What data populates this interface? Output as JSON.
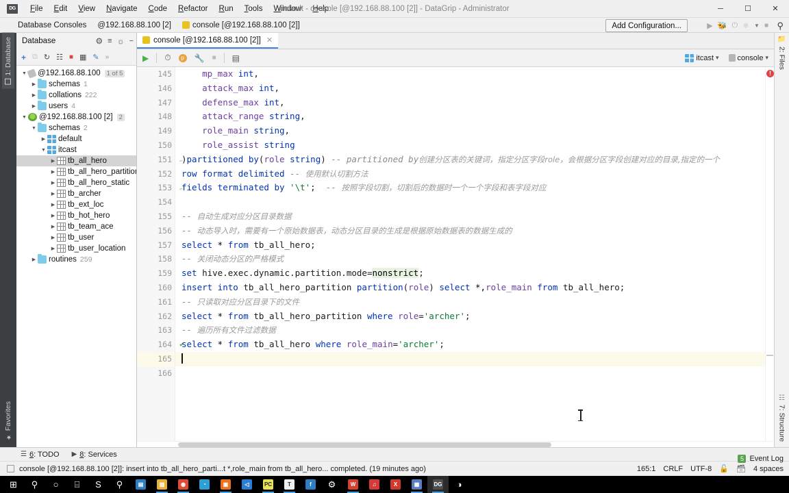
{
  "window": {
    "title": "default - console [@192.168.88.100 [2]] - DataGrip - Administrator",
    "app_icon_label": "DG",
    "minimize": "─",
    "maximize": "☐",
    "close": "✕"
  },
  "menu": [
    {
      "label": "File"
    },
    {
      "label": "Edit"
    },
    {
      "label": "View"
    },
    {
      "label": "Navigate"
    },
    {
      "label": "Code"
    },
    {
      "label": "Refactor"
    },
    {
      "label": "Run"
    },
    {
      "label": "Tools"
    },
    {
      "label": "Window"
    },
    {
      "label": "Help"
    }
  ],
  "consoles_bar": {
    "label": "Database Consoles",
    "breadcrumb": "@192.168.88.100 [2]",
    "console_item": "console [@192.168.88.100 [2]]",
    "add_configuration": "Add Configuration...",
    "run_icon": "run-icon",
    "debug_icon": "debug-icon",
    "coverage_icon": "coverage-icon",
    "profile_icon": "profile-icon",
    "stop_icon": "stop-icon",
    "search_icon": "search-icon"
  },
  "left_strip": {
    "database_tab": "1: Database",
    "favorites_tab": "Favorites"
  },
  "database_panel": {
    "title": "Database",
    "header_icons": [
      "sync-icon",
      "collapse-icon",
      "settings-icon",
      "hide-icon"
    ],
    "toolbar_icons": [
      "add-icon",
      "duplicate-icon",
      "refresh-icon",
      "run-script-icon",
      "stop-icon",
      "table-editor-icon",
      "modify-icon",
      "more-icon"
    ],
    "tree": [
      {
        "indent": 0,
        "arrow": "▼",
        "icon": "db-offline-icon",
        "name": "@192.168.88.100",
        "badge": "1 of 5",
        "count": "",
        "selected": false
      },
      {
        "indent": 1,
        "arrow": "▶",
        "icon": "folder-icon",
        "name": "schemas",
        "badge": "",
        "count": "1",
        "selected": false
      },
      {
        "indent": 1,
        "arrow": "▶",
        "icon": "folder-icon",
        "name": "collations",
        "badge": "",
        "count": "222",
        "selected": false
      },
      {
        "indent": 1,
        "arrow": "▶",
        "icon": "folder-icon",
        "name": "users",
        "badge": "",
        "count": "4",
        "selected": false
      },
      {
        "indent": 0,
        "arrow": "▼",
        "icon": "db-online-icon",
        "name": "@192.168.88.100 [2]",
        "badge": "2",
        "count": "",
        "selected": false
      },
      {
        "indent": 1,
        "arrow": "▼",
        "icon": "folder-icon",
        "name": "schemas",
        "badge": "",
        "count": "2",
        "selected": false
      },
      {
        "indent": 2,
        "arrow": "▶",
        "icon": "schema-icon",
        "name": "default",
        "badge": "",
        "count": "",
        "selected": false
      },
      {
        "indent": 2,
        "arrow": "▼",
        "icon": "schema-icon",
        "name": "itcast",
        "badge": "",
        "count": "",
        "selected": false
      },
      {
        "indent": 3,
        "arrow": "▶",
        "icon": "table-icon",
        "name": "tb_all_hero",
        "badge": "",
        "count": "",
        "selected": true
      },
      {
        "indent": 3,
        "arrow": "▶",
        "icon": "table-icon",
        "name": "tb_all_hero_partition",
        "badge": "",
        "count": "",
        "selected": false
      },
      {
        "indent": 3,
        "arrow": "▶",
        "icon": "table-icon",
        "name": "tb_all_hero_static",
        "badge": "",
        "count": "",
        "selected": false
      },
      {
        "indent": 3,
        "arrow": "▶",
        "icon": "table-icon",
        "name": "tb_archer",
        "badge": "",
        "count": "",
        "selected": false
      },
      {
        "indent": 3,
        "arrow": "▶",
        "icon": "table-icon",
        "name": "tb_ext_loc",
        "badge": "",
        "count": "",
        "selected": false
      },
      {
        "indent": 3,
        "arrow": "▶",
        "icon": "table-icon",
        "name": "tb_hot_hero",
        "badge": "",
        "count": "",
        "selected": false
      },
      {
        "indent": 3,
        "arrow": "▶",
        "icon": "table-icon",
        "name": "tb_team_ace",
        "badge": "",
        "count": "",
        "selected": false
      },
      {
        "indent": 3,
        "arrow": "▶",
        "icon": "table-icon",
        "name": "tb_user",
        "badge": "",
        "count": "",
        "selected": false
      },
      {
        "indent": 3,
        "arrow": "▶",
        "icon": "table-icon",
        "name": "tb_user_location",
        "badge": "",
        "count": "",
        "selected": false
      },
      {
        "indent": 1,
        "arrow": "▶",
        "icon": "folder-icon",
        "name": "routines",
        "badge": "",
        "count": "259",
        "selected": false
      }
    ]
  },
  "editor": {
    "tab_label": "console [@192.168.88.100 [2]]",
    "tab_close": "✕",
    "toolbar_icons": [
      "execute-icon",
      "history-icon",
      "parameters-icon",
      "wrench-icon",
      "stop-icon",
      "grid-icon"
    ],
    "schema_chip": "itcast",
    "session_chip": "console",
    "chevron": "⌄",
    "first_line_number": 145,
    "lines": [
      {
        "n": 145,
        "segments": [
          {
            "t": "plain",
            "s": "    "
          },
          {
            "t": "col",
            "s": "mp_max"
          },
          {
            "t": "plain",
            "s": " "
          },
          {
            "t": "kw",
            "s": "int"
          },
          {
            "t": "punct",
            "s": ","
          }
        ]
      },
      {
        "n": 146,
        "segments": [
          {
            "t": "plain",
            "s": "    "
          },
          {
            "t": "col",
            "s": "attack_max"
          },
          {
            "t": "plain",
            "s": " "
          },
          {
            "t": "kw",
            "s": "int"
          },
          {
            "t": "punct",
            "s": ","
          }
        ]
      },
      {
        "n": 147,
        "segments": [
          {
            "t": "plain",
            "s": "    "
          },
          {
            "t": "col",
            "s": "defense_max"
          },
          {
            "t": "plain",
            "s": " "
          },
          {
            "t": "kw",
            "s": "int"
          },
          {
            "t": "punct",
            "s": ","
          }
        ]
      },
      {
        "n": 148,
        "segments": [
          {
            "t": "plain",
            "s": "    "
          },
          {
            "t": "col",
            "s": "attack_range"
          },
          {
            "t": "plain",
            "s": " "
          },
          {
            "t": "kw",
            "s": "string"
          },
          {
            "t": "punct",
            "s": ","
          }
        ]
      },
      {
        "n": 149,
        "segments": [
          {
            "t": "plain",
            "s": "    "
          },
          {
            "t": "col",
            "s": "role_main"
          },
          {
            "t": "plain",
            "s": " "
          },
          {
            "t": "kw",
            "s": "string"
          },
          {
            "t": "punct",
            "s": ","
          }
        ]
      },
      {
        "n": 150,
        "segments": [
          {
            "t": "plain",
            "s": "    "
          },
          {
            "t": "col",
            "s": "role_assist"
          },
          {
            "t": "plain",
            "s": " "
          },
          {
            "t": "kw",
            "s": "string"
          }
        ]
      },
      {
        "n": 151,
        "fold": true,
        "segments": [
          {
            "t": "punct",
            "s": ")"
          },
          {
            "t": "kw",
            "s": "partitioned by"
          },
          {
            "t": "punct",
            "s": "("
          },
          {
            "t": "col",
            "s": "role"
          },
          {
            "t": "plain",
            "s": " "
          },
          {
            "t": "kw",
            "s": "string"
          },
          {
            "t": "punct",
            "s": ")"
          },
          {
            "t": "cmt",
            "s": " -- "
          },
          {
            "t": "cmt",
            "s": "partitioned by"
          },
          {
            "t": "cmt-cn",
            "s": "创建分区表的关键词，指定分区字段role，会根据分区字段创建对应的目录,指定的一个"
          }
        ]
      },
      {
        "n": 152,
        "segments": [
          {
            "t": "kw",
            "s": "row format delimited"
          },
          {
            "t": "cmt",
            "s": " -- "
          },
          {
            "t": "cmt-cn",
            "s": "使用默认切割方法"
          }
        ]
      },
      {
        "n": 153,
        "fold": true,
        "segments": [
          {
            "t": "kw",
            "s": "fields terminated by"
          },
          {
            "t": "plain",
            "s": " "
          },
          {
            "t": "str",
            "s": "'\\t'"
          },
          {
            "t": "punct",
            "s": ";"
          },
          {
            "t": "cmt",
            "s": "  -- "
          },
          {
            "t": "cmt-cn",
            "s": "按照字段切割，切割后的数据时一个一个字段和表字段对应"
          }
        ]
      },
      {
        "n": 154,
        "segments": []
      },
      {
        "n": 155,
        "segments": [
          {
            "t": "cmt",
            "s": "-- "
          },
          {
            "t": "cmt-cn",
            "s": "自动生成对应分区目录数据"
          }
        ]
      },
      {
        "n": 156,
        "segments": [
          {
            "t": "cmt",
            "s": "-- "
          },
          {
            "t": "cmt-cn",
            "s": "动态导入时，需要有一个原始数据表，动态分区目录的生成是根据原始数据表的数据生成的"
          }
        ]
      },
      {
        "n": 157,
        "segments": [
          {
            "t": "kw",
            "s": "select"
          },
          {
            "t": "plain",
            "s": " * "
          },
          {
            "t": "kw",
            "s": "from"
          },
          {
            "t": "plain",
            "s": " "
          },
          {
            "t": "tbl",
            "s": "tb_all_hero"
          },
          {
            "t": "punct",
            "s": ";"
          }
        ]
      },
      {
        "n": 158,
        "segments": [
          {
            "t": "cmt",
            "s": "-- "
          },
          {
            "t": "cmt-cn",
            "s": "关闭动态分区的严格模式"
          }
        ]
      },
      {
        "n": 159,
        "segments": [
          {
            "t": "kw",
            "s": "set"
          },
          {
            "t": "plain",
            "s": " "
          },
          {
            "t": "id",
            "s": "hive.exec.dynamic.partition.mode"
          },
          {
            "t": "punct",
            "s": "="
          },
          {
            "t": "hl",
            "s": "nonstrict"
          },
          {
            "t": "punct",
            "s": ";"
          }
        ]
      },
      {
        "n": 160,
        "segments": [
          {
            "t": "kw",
            "s": "insert into"
          },
          {
            "t": "plain",
            "s": " "
          },
          {
            "t": "tbl",
            "s": "tb_all_hero_partition"
          },
          {
            "t": "plain",
            "s": " "
          },
          {
            "t": "kw",
            "s": "partition"
          },
          {
            "t": "punct",
            "s": "("
          },
          {
            "t": "col",
            "s": "role"
          },
          {
            "t": "punct",
            "s": ") "
          },
          {
            "t": "kw",
            "s": "select"
          },
          {
            "t": "plain",
            "s": " *,"
          },
          {
            "t": "col",
            "s": "role_main"
          },
          {
            "t": "plain",
            "s": " "
          },
          {
            "t": "kw",
            "s": "from"
          },
          {
            "t": "plain",
            "s": " "
          },
          {
            "t": "tbl",
            "s": "tb_all_hero"
          },
          {
            "t": "punct",
            "s": ";"
          }
        ]
      },
      {
        "n": 161,
        "segments": [
          {
            "t": "cmt",
            "s": "-- "
          },
          {
            "t": "cmt-cn",
            "s": "只读取对应分区目录下的文件"
          }
        ]
      },
      {
        "n": 162,
        "segments": [
          {
            "t": "kw",
            "s": "select"
          },
          {
            "t": "plain",
            "s": " * "
          },
          {
            "t": "kw",
            "s": "from"
          },
          {
            "t": "plain",
            "s": " "
          },
          {
            "t": "tbl",
            "s": "tb_all_hero_partition"
          },
          {
            "t": "plain",
            "s": " "
          },
          {
            "t": "kw",
            "s": "where"
          },
          {
            "t": "plain",
            "s": " "
          },
          {
            "t": "col",
            "s": "role"
          },
          {
            "t": "punct",
            "s": "="
          },
          {
            "t": "str",
            "s": "'archer'"
          },
          {
            "t": "punct",
            "s": ";"
          }
        ]
      },
      {
        "n": 163,
        "segments": [
          {
            "t": "cmt",
            "s": "-- "
          },
          {
            "t": "cmt-cn",
            "s": "遍历所有文件过滤数据"
          }
        ]
      },
      {
        "n": 164,
        "check": true,
        "segments": [
          {
            "t": "kw",
            "s": "select"
          },
          {
            "t": "plain",
            "s": " * "
          },
          {
            "t": "kw",
            "s": "from"
          },
          {
            "t": "plain",
            "s": " "
          },
          {
            "t": "tbl",
            "s": "tb_all_hero"
          },
          {
            "t": "plain",
            "s": " "
          },
          {
            "t": "kw",
            "s": "where"
          },
          {
            "t": "plain",
            "s": " "
          },
          {
            "t": "col",
            "s": "role_main"
          },
          {
            "t": "punct",
            "s": "="
          },
          {
            "t": "str",
            "s": "'archer'"
          },
          {
            "t": "punct",
            "s": ";"
          }
        ]
      },
      {
        "n": 165,
        "current": true,
        "caret": true,
        "segments": []
      },
      {
        "n": 166,
        "segments": []
      }
    ]
  },
  "right_strip": {
    "files_tab": "2: Files",
    "structure_tab": "7: Structure"
  },
  "bottom_toolwindows": [
    {
      "icon": "todo-icon",
      "key": "6",
      "label": ": TODO"
    },
    {
      "icon": "services-icon",
      "key": "8",
      "label": ": Services"
    }
  ],
  "statusbar": {
    "message_icon": "console-icon",
    "message": "console [@192.168.88.100 [2]]: insert into tb_all_hero_parti...t *,role_main from tb_all_hero... completed. (19 minutes ago)",
    "caret_position": "165:1",
    "line_separator": "CRLF",
    "encoding": "UTF-8",
    "lock_icon": "unlocked-icon",
    "vcs_icon": "branch-icon",
    "indent": "4 spaces"
  },
  "event_log": {
    "badge": "5",
    "label": "Event Log"
  },
  "taskbar": [
    {
      "name": "start-button",
      "glyph": "⊞",
      "color": "#ffffff",
      "bg": "transparent",
      "active": false,
      "underline": false
    },
    {
      "name": "search-icon",
      "glyph": "⚲",
      "color": "#ffffff",
      "bg": "transparent",
      "active": false,
      "underline": false
    },
    {
      "name": "cortana-icon",
      "glyph": "○",
      "color": "#ffffff",
      "bg": "transparent",
      "active": false,
      "underline": false
    },
    {
      "name": "task-view-icon",
      "glyph": "⌸",
      "color": "#ffffff",
      "bg": "transparent",
      "active": false,
      "underline": false
    },
    {
      "name": "app-sogou-icon",
      "glyph": "S",
      "color": "#ffffff",
      "bg": "transparent",
      "active": false,
      "underline": false
    },
    {
      "name": "app-search-icon",
      "glyph": "⚲",
      "color": "#ffffff",
      "bg": "transparent",
      "active": false,
      "underline": false
    },
    {
      "name": "app-store-icon",
      "glyph": "▤",
      "color": "#ffffff",
      "bg": "#2e7ec4",
      "active": false,
      "underline": false
    },
    {
      "name": "app-explorer-icon",
      "glyph": "▧",
      "color": "#ffffff",
      "bg": "#e8b23a",
      "active": false,
      "underline": true
    },
    {
      "name": "app-chrome-icon",
      "glyph": "◉",
      "color": "#ffffff",
      "bg": "#e04a36",
      "active": false,
      "underline": true
    },
    {
      "name": "app-edge-icon",
      "glyph": "◔",
      "color": "#ffffff",
      "bg": "#2e9fd6",
      "active": false,
      "underline": false
    },
    {
      "name": "app-office-icon",
      "glyph": "▣",
      "color": "#ffffff",
      "bg": "#e8721e",
      "active": false,
      "underline": true
    },
    {
      "name": "app-vscode-icon",
      "glyph": "◁",
      "color": "#ffffff",
      "bg": "#2a7fd4",
      "active": false,
      "underline": false
    },
    {
      "name": "app-pycharm-icon",
      "glyph": "PC",
      "color": "#1f1f1f",
      "bg": "#e6e35a",
      "active": false,
      "underline": true
    },
    {
      "name": "app-typora-icon",
      "glyph": "T",
      "color": "#2a2a2a",
      "bg": "#f0f0f0",
      "active": false,
      "underline": true
    },
    {
      "name": "app-feishu-icon",
      "glyph": "f",
      "color": "#ffffff",
      "bg": "#2e7ec4",
      "active": false,
      "underline": false
    },
    {
      "name": "app-settings-icon",
      "glyph": "⚙",
      "color": "#ffffff",
      "bg": "transparent",
      "active": false,
      "underline": false
    },
    {
      "name": "app-wps-icon",
      "glyph": "W",
      "color": "#ffffff",
      "bg": "#d64030",
      "active": false,
      "underline": true
    },
    {
      "name": "app-netease-icon",
      "glyph": "♫",
      "color": "#ffffff",
      "bg": "#d43a3a",
      "active": false,
      "underline": false
    },
    {
      "name": "app-excel-icon",
      "glyph": "X",
      "color": "#ffffff",
      "bg": "#cf3a2a",
      "active": false,
      "underline": false
    },
    {
      "name": "app-vm-icon",
      "glyph": "▦",
      "color": "#ffffff",
      "bg": "#5a7fc0",
      "active": false,
      "underline": true
    },
    {
      "name": "app-datagrip-icon",
      "glyph": "DG",
      "color": "#ffffff",
      "bg": "#4a4f54",
      "active": true,
      "underline": true
    },
    {
      "name": "app-other-icon",
      "glyph": "◑",
      "color": "#ffffff",
      "bg": "transparent",
      "active": false,
      "underline": false
    }
  ]
}
